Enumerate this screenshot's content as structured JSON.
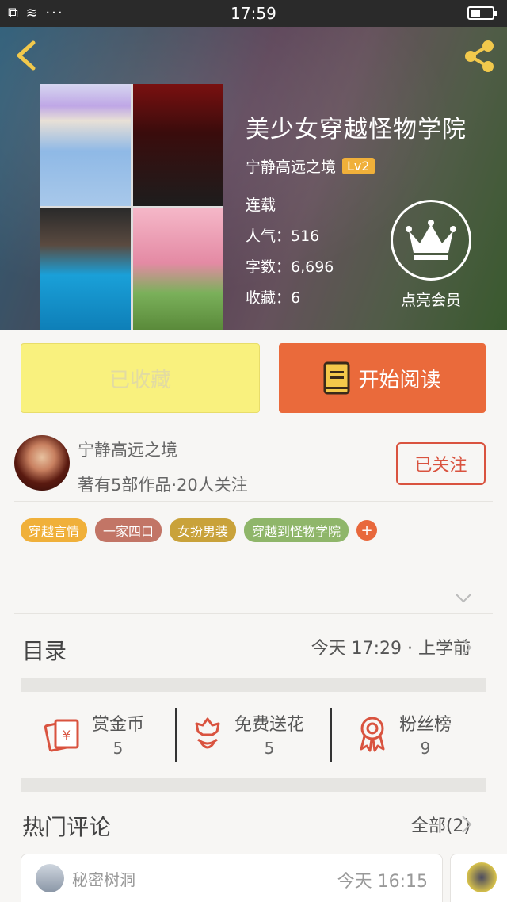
{
  "status_bar": {
    "left_icons": "⧉ ≋ ···",
    "time": "17:59",
    "battery_level": 0.45
  },
  "book": {
    "title": "美少女穿越怪物学院",
    "author": "宁静高远之境",
    "author_level": "Lv2",
    "status": "连载",
    "popularity": "人气：516",
    "word_count": "字数：6,696",
    "favorites": "收藏：6",
    "vip_label": "点亮会员"
  },
  "actions": {
    "favorite_label": "已收藏",
    "read_label": "开始阅读"
  },
  "author_card": {
    "name": "宁静高远之境",
    "meta": "著有5部作品·20人关注",
    "follow_label": "已关注"
  },
  "tags": [
    {
      "label": "穿越言情",
      "color": "#f0b03a"
    },
    {
      "label": "一家四口",
      "color": "#c27566"
    },
    {
      "label": "女扮男装",
      "color": "#c9a23a"
    },
    {
      "label": "穿越到怪物学院",
      "color": "#8fb66a"
    }
  ],
  "catalog": {
    "title": "目录",
    "latest": "今天 17:29 · 上学前"
  },
  "gifts": [
    {
      "label": "赏金币",
      "count": "5",
      "icon": "coin-envelope-icon"
    },
    {
      "label": "免费送花",
      "count": "5",
      "icon": "flower-icon"
    },
    {
      "label": "粉丝榜",
      "count": "9",
      "icon": "ribbon-medal-icon"
    }
  ],
  "comments": {
    "title": "热门评论",
    "all_label": "全部(2)",
    "items": [
      {
        "user": "秘密树洞",
        "time": "今天 16:15"
      }
    ]
  },
  "colors": {
    "accent": "#ea6a3b",
    "favorite_bg": "#f9f17e",
    "follow": "#d9533f",
    "gift_icon": "#d9533f"
  }
}
